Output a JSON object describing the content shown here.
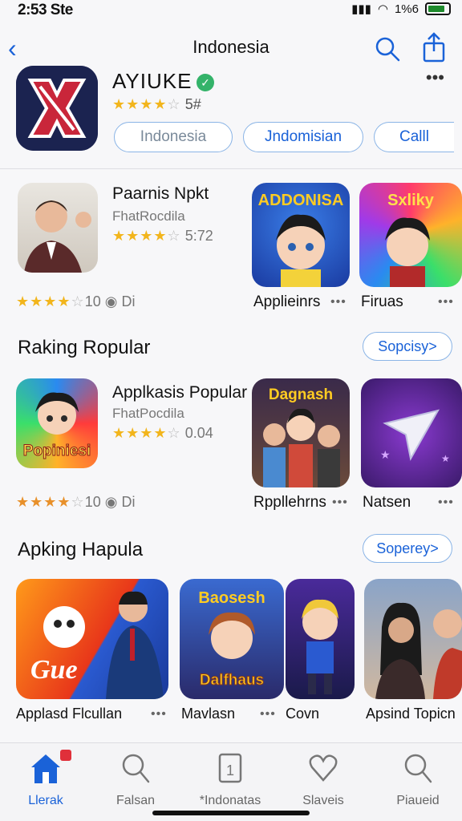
{
  "status_bar": {
    "time": "2:53 Ste",
    "battery": "1%6"
  },
  "nav": {
    "title": "Indonesia"
  },
  "hero": {
    "name": "AYIUKE",
    "rating_text": "5#",
    "pills": [
      "Indonesia",
      "Jndomisian",
      "Calll"
    ]
  },
  "row1": {
    "featured": {
      "name": "Paarnis Npkt",
      "developer": "FhatRocdila",
      "rating_text": "5:72"
    },
    "apps": [
      {
        "name": "Applieinrs"
      },
      {
        "name": "Firuas"
      }
    ],
    "left_rating_text": "10",
    "left_extra": "Di"
  },
  "section1": {
    "title": "Raking Ropular",
    "see_all": "Sopcisy>"
  },
  "row2": {
    "featured": {
      "name": "Applkasis Popular",
      "developer": "FhatPocdila",
      "rating_text": "0.04"
    },
    "apps": [
      {
        "name": "Rppllehrns"
      },
      {
        "name": "Natsen"
      }
    ],
    "left_rating_text": "10",
    "left_extra": "Di",
    "icon_text": "Popiniesi"
  },
  "section2": {
    "title": "Apking Hapula",
    "see_all": "Soperey>"
  },
  "row3": {
    "apps": [
      {
        "name": "Applasd Flcullan"
      },
      {
        "name": "Mavlasn"
      },
      {
        "name": "Covn"
      },
      {
        "name": "Apsind Topicn"
      }
    ],
    "icon1_text": "Gue",
    "icon2_text": "Dalfhaus"
  },
  "tabs": [
    {
      "label": "Llerak",
      "icon": "house-icon",
      "active": true
    },
    {
      "label": "Falsan",
      "icon": "search-icon"
    },
    {
      "label": "*Indonatas",
      "icon": "badge-one-icon"
    },
    {
      "label": "Slaveis",
      "icon": "heart-icon"
    },
    {
      "label": "Piaueid",
      "icon": "search-icon"
    }
  ],
  "colors": {
    "accent": "#1a62d8",
    "star": "#f2b51c",
    "pill_border": "#8ab4e6"
  }
}
